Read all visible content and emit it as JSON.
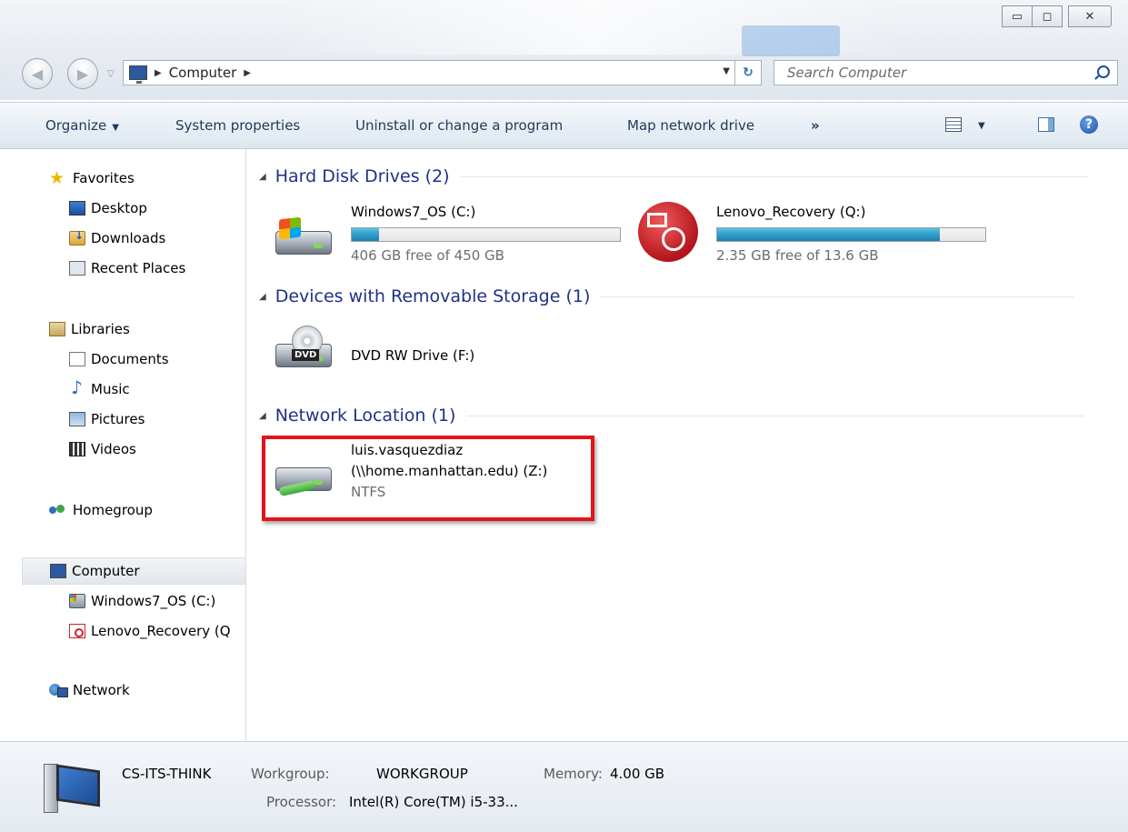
{
  "address": {
    "location": "Computer",
    "search_placeholder": "Search Computer"
  },
  "window_controls": {
    "minimize": "▭",
    "maximize": "◻",
    "close": "✕"
  },
  "toolbar": {
    "organize": "Organize",
    "system_properties": "System properties",
    "uninstall": "Uninstall or change a program",
    "map_drive": "Map network drive",
    "more": "»"
  },
  "nav": {
    "favorites": {
      "label": "Favorites",
      "items": [
        "Desktop",
        "Downloads",
        "Recent Places"
      ]
    },
    "libraries": {
      "label": "Libraries",
      "items": [
        "Documents",
        "Music",
        "Pictures",
        "Videos"
      ]
    },
    "homegroup": "Homegroup",
    "computer": {
      "label": "Computer",
      "items": [
        "Windows7_OS (C:)",
        "Lenovo_Recovery (Q"
      ]
    },
    "network": "Network"
  },
  "groups": {
    "hdd": {
      "title": "Hard Disk Drives (2)",
      "drives": [
        {
          "name": "Windows7_OS (C:)",
          "free": "406 GB free of 450 GB",
          "used_fraction": 0.1
        },
        {
          "name": "Lenovo_Recovery (Q:)",
          "free": "2.35 GB free of 13.6 GB",
          "used_fraction": 0.83
        }
      ]
    },
    "removable": {
      "title": "Devices with Removable Storage (1)",
      "dvd": {
        "name": "DVD RW Drive (F:)",
        "badge": "DVD"
      }
    },
    "network": {
      "title": "Network Location (1)",
      "location": {
        "line1": "luis.vasquezdiaz",
        "line2": "(\\\\home.manhattan.edu) (Z:)",
        "fs": "NTFS"
      }
    }
  },
  "details": {
    "computer_name": "CS-ITS-THINK",
    "workgroup_label": "Workgroup:",
    "workgroup": "WORKGROUP",
    "memory_label": "Memory:",
    "memory": "4.00 GB",
    "processor_label": "Processor:",
    "processor": "Intel(R) Core(TM) i5-33..."
  }
}
